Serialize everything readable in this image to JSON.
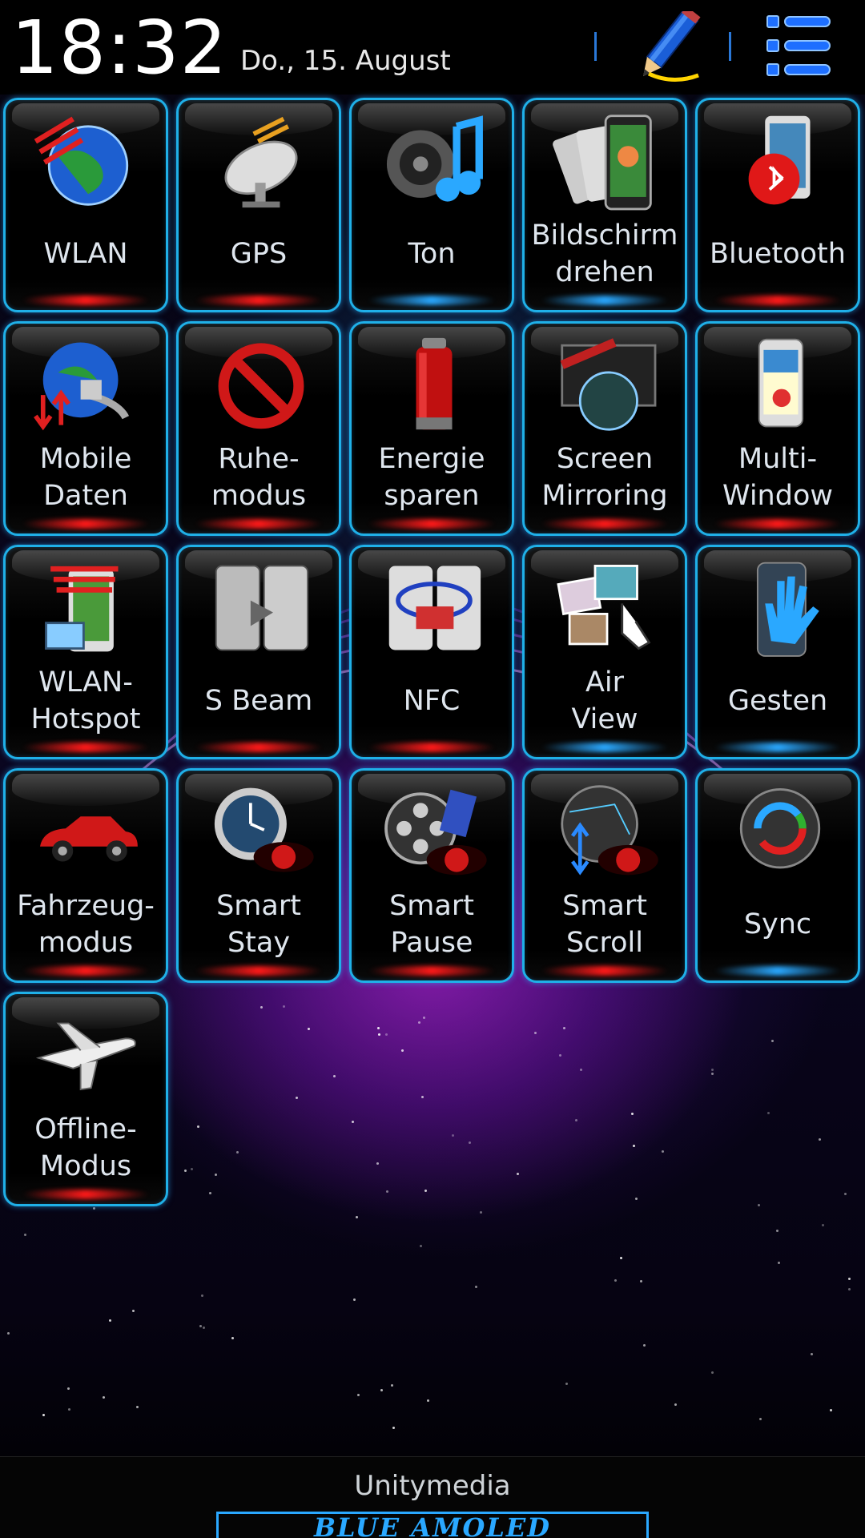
{
  "status": {
    "time": "18:32",
    "date": "Do., 15. August"
  },
  "toolbar": {
    "edit_icon": "pencil-icon",
    "menu_icon": "list-menu-icon"
  },
  "tiles": [
    {
      "label": "WLAN",
      "icon": "globe-wifi-icon",
      "state": "off"
    },
    {
      "label": "GPS",
      "icon": "satellite-dish-icon",
      "state": "off"
    },
    {
      "label": "Ton",
      "icon": "speaker-note-icon",
      "state": "on"
    },
    {
      "label": "Bildschirm\ndrehen",
      "icon": "rotate-phones-icon",
      "state": "on"
    },
    {
      "label": "Bluetooth",
      "icon": "bluetooth-phone-icon",
      "state": "off"
    },
    {
      "label": "Mobile\nDaten",
      "icon": "globe-data-icon",
      "state": "off"
    },
    {
      "label": "Ruhe-\nmodus",
      "icon": "prohibited-icon",
      "state": "off"
    },
    {
      "label": "Energie\nsparen",
      "icon": "battery-icon",
      "state": "off"
    },
    {
      "label": "Screen\nMirroring",
      "icon": "allshare-tv-icon",
      "state": "off"
    },
    {
      "label": "Multi-\nWindow",
      "icon": "multi-window-phone-icon",
      "state": "off"
    },
    {
      "label": "WLAN-\nHotspot",
      "icon": "hotspot-phone-icon",
      "state": "off"
    },
    {
      "label": "S Beam",
      "icon": "s-beam-phones-icon",
      "state": "off"
    },
    {
      "label": "NFC",
      "icon": "nfc-phones-icon",
      "state": "off"
    },
    {
      "label": "Air\nView",
      "icon": "air-view-photos-icon",
      "state": "on"
    },
    {
      "label": "Gesten",
      "icon": "hand-phone-icon",
      "state": "on"
    },
    {
      "label": "Fahrzeug-\nmodus",
      "icon": "car-icon",
      "state": "off"
    },
    {
      "label": "Smart\nStay",
      "icon": "clock-eye-icon",
      "state": "off"
    },
    {
      "label": "Smart\nPause",
      "icon": "film-reel-eye-icon",
      "state": "off"
    },
    {
      "label": "Smart\nScroll",
      "icon": "globe-eye-icon",
      "state": "off"
    },
    {
      "label": "Sync",
      "icon": "sync-globe-icon",
      "state": "on"
    },
    {
      "label": "Offline-\nModus",
      "icon": "airplane-icon",
      "state": "off"
    }
  ],
  "footer": {
    "carrier": "Unitymedia",
    "brand": "BLUE AMOLED"
  },
  "colors": {
    "accent": "#1fb0e8",
    "on_glow": "#2aa8ff",
    "off_glow": "#ff1a1a"
  }
}
